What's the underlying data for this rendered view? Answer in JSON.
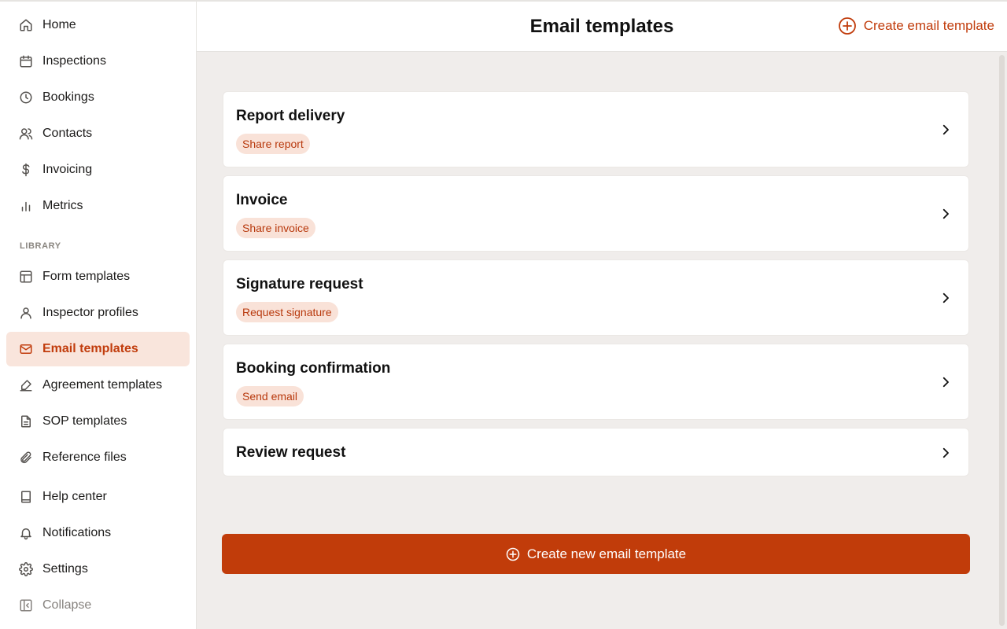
{
  "sidebar": {
    "items": [
      {
        "label": "Home",
        "icon": "home-icon"
      },
      {
        "label": "Inspections",
        "icon": "calendar-icon"
      },
      {
        "label": "Bookings",
        "icon": "clock-icon"
      },
      {
        "label": "Contacts",
        "icon": "users-icon"
      },
      {
        "label": "Invoicing",
        "icon": "dollar-icon"
      },
      {
        "label": "Metrics",
        "icon": "bar-chart-icon"
      }
    ],
    "section_label": "LIBRARY",
    "library_items": [
      {
        "label": "Form templates",
        "icon": "layout-icon"
      },
      {
        "label": "Inspector profiles",
        "icon": "user-icon"
      },
      {
        "label": "Email templates",
        "icon": "mail-icon",
        "active": true
      },
      {
        "label": "Agreement templates",
        "icon": "signature-icon"
      },
      {
        "label": "SOP templates",
        "icon": "document-icon"
      },
      {
        "label": "Reference files",
        "icon": "paperclip-icon"
      }
    ],
    "bottom_items": [
      {
        "label": "Help center",
        "icon": "book-icon"
      },
      {
        "label": "Notifications",
        "icon": "bell-icon"
      },
      {
        "label": "Settings",
        "icon": "gear-icon"
      },
      {
        "label": "Collapse",
        "icon": "sidebar-collapse-icon"
      }
    ]
  },
  "header": {
    "title": "Email templates",
    "create_label": "Create email template"
  },
  "templates": [
    {
      "title": "Report delivery",
      "badge": "Share report"
    },
    {
      "title": "Invoice",
      "badge": "Share invoice"
    },
    {
      "title": "Signature request",
      "badge": "Request signature"
    },
    {
      "title": "Booking confirmation",
      "badge": "Send email"
    },
    {
      "title": "Review request"
    }
  ],
  "primary_button": {
    "label": "Create new email template"
  },
  "colors": {
    "accent": "#c13c0a",
    "active_bg": "#f9e5dc",
    "badge_bg": "#f9e2d8",
    "main_bg": "#f0edeb"
  }
}
